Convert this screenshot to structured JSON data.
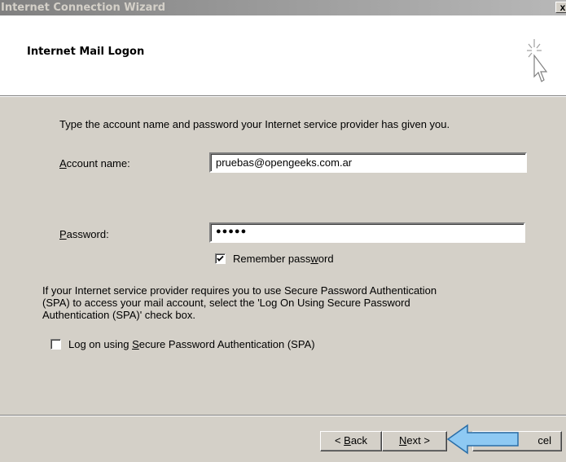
{
  "window": {
    "title": "Internet Connection Wizard",
    "close_glyph": "x"
  },
  "header": {
    "heading": "Internet Mail Logon",
    "icon": "wizard-cursor-sparkle-icon"
  },
  "body": {
    "instruction": "Type the account name and password your Internet service provider has given you.",
    "account_label_mnemonic": "A",
    "account_label_rest": "ccount name:",
    "account_value": "pruebas@opengeeks.com.ar",
    "password_label_mnemonic": "P",
    "password_label_rest": "assword:",
    "password_mask": "●●●●●",
    "remember_checked": true,
    "remember_label_pre": "Remember pass",
    "remember_label_mnemonic": "w",
    "remember_label_post": "ord",
    "spa_text_line1": "If your Internet service provider requires you to use Secure Password Authentication",
    "spa_text_line2": "(SPA) to access your mail account, select the 'Log On Using Secure Password",
    "spa_text_line3": "Authentication (SPA)' check box.",
    "spa_checked": false,
    "spa_label_pre": "Log on using ",
    "spa_label_mnemonic": "S",
    "spa_label_post": "ecure Password Authentication (SPA)"
  },
  "buttons": {
    "back_pre": "< ",
    "back_mnemonic": "B",
    "back_post": "ack",
    "next_mnemonic": "N",
    "next_post": "ext >",
    "cancel_visible": "cel"
  },
  "annotation": {
    "arrow_color": "#8ec9f3",
    "arrow_outline": "#2a6ea8"
  }
}
